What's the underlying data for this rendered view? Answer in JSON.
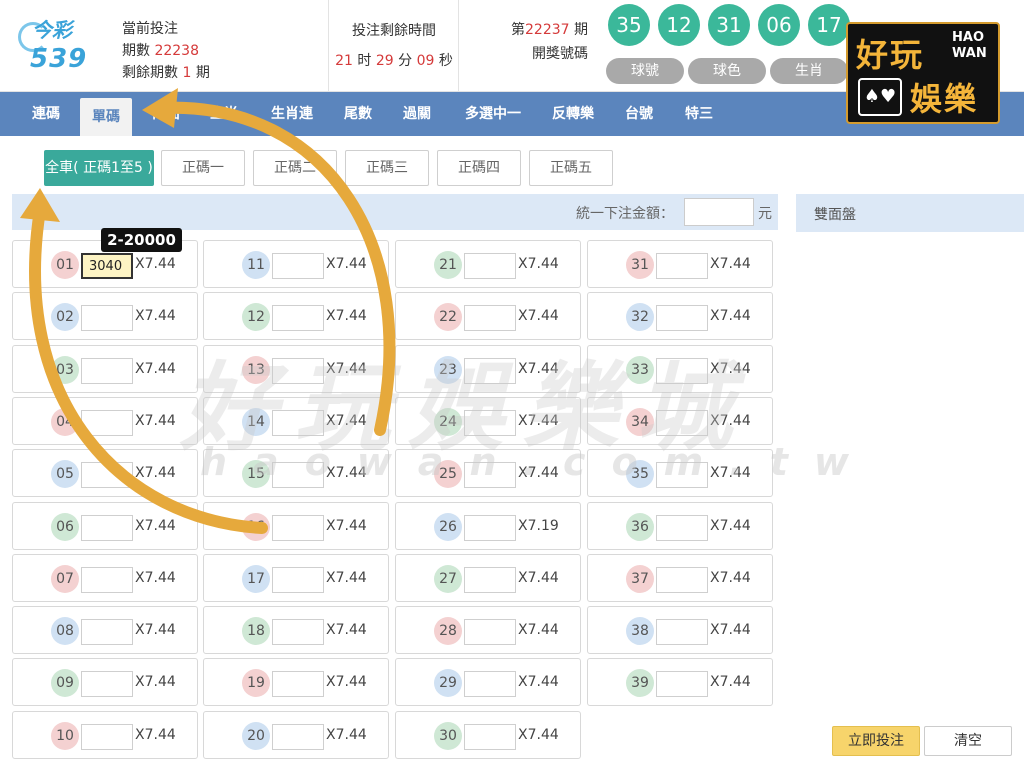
{
  "logo": {
    "top_text": "今彩",
    "num_text": "539"
  },
  "header": {
    "current_bet_label": "當前投注",
    "period_label": "期數",
    "period_value": "22238",
    "remaining_label": "剩餘期數",
    "remaining_value": "1",
    "remaining_unit": "期",
    "countdown_label": "投注剩餘時間",
    "time_h": "21",
    "time_h_unit": "时",
    "time_m": "29",
    "time_m_unit": "分",
    "time_s": "09",
    "time_s_unit": "秒",
    "draw_prefix": "第",
    "draw_period": "22237",
    "draw_suffix": "期",
    "draw_label": "開獎號碼",
    "balls": [
      "35",
      "12",
      "31",
      "06",
      "17"
    ],
    "ball_tabs": [
      "球號",
      "球色",
      "生肖"
    ]
  },
  "brand": {
    "cn1": "好玩",
    "en1": "HAO",
    "en2": "WAN",
    "cn2": "娛樂",
    "cards": "♠♥"
  },
  "nav": [
    "連碼",
    "單碼",
    "兩面",
    "生肖",
    "生肖連",
    "尾數",
    "過關",
    "多選中一",
    "反轉樂",
    "台號",
    "特三"
  ],
  "subtabs": [
    "全車( 正碼1至5 )",
    "正碼一",
    "正碼二",
    "正碼三",
    "正碼四",
    "正碼五"
  ],
  "amount": {
    "label": "統一下注金額：",
    "unit": "元"
  },
  "side_panel": {
    "title": "雙面盤"
  },
  "tooltip": "2-20000",
  "numbers": [
    {
      "n": "01",
      "c": "red",
      "odds": "X7.44",
      "val": "3040"
    },
    {
      "n": "02",
      "c": "blue",
      "odds": "X7.44",
      "val": ""
    },
    {
      "n": "03",
      "c": "green",
      "odds": "X7.44",
      "val": ""
    },
    {
      "n": "04",
      "c": "red",
      "odds": "X7.44",
      "val": ""
    },
    {
      "n": "05",
      "c": "blue",
      "odds": "X7.44",
      "val": ""
    },
    {
      "n": "06",
      "c": "green",
      "odds": "X7.44",
      "val": ""
    },
    {
      "n": "07",
      "c": "red",
      "odds": "X7.44",
      "val": ""
    },
    {
      "n": "08",
      "c": "blue",
      "odds": "X7.44",
      "val": ""
    },
    {
      "n": "09",
      "c": "green",
      "odds": "X7.44",
      "val": ""
    },
    {
      "n": "10",
      "c": "red",
      "odds": "X7.44",
      "val": ""
    },
    {
      "n": "11",
      "c": "blue",
      "odds": "X7.44",
      "val": ""
    },
    {
      "n": "12",
      "c": "green",
      "odds": "X7.44",
      "val": ""
    },
    {
      "n": "13",
      "c": "red",
      "odds": "X7.44",
      "val": ""
    },
    {
      "n": "14",
      "c": "blue",
      "odds": "X7.44",
      "val": ""
    },
    {
      "n": "15",
      "c": "green",
      "odds": "X7.44",
      "val": ""
    },
    {
      "n": "16",
      "c": "red",
      "odds": "X7.44",
      "val": ""
    },
    {
      "n": "17",
      "c": "blue",
      "odds": "X7.44",
      "val": ""
    },
    {
      "n": "18",
      "c": "green",
      "odds": "X7.44",
      "val": ""
    },
    {
      "n": "19",
      "c": "red",
      "odds": "X7.44",
      "val": ""
    },
    {
      "n": "20",
      "c": "blue",
      "odds": "X7.44",
      "val": ""
    },
    {
      "n": "21",
      "c": "green",
      "odds": "X7.44",
      "val": ""
    },
    {
      "n": "22",
      "c": "red",
      "odds": "X7.44",
      "val": ""
    },
    {
      "n": "23",
      "c": "blue",
      "odds": "X7.44",
      "val": ""
    },
    {
      "n": "24",
      "c": "green",
      "odds": "X7.44",
      "val": ""
    },
    {
      "n": "25",
      "c": "red",
      "odds": "X7.44",
      "val": ""
    },
    {
      "n": "26",
      "c": "blue",
      "odds": "X7.19",
      "val": ""
    },
    {
      "n": "27",
      "c": "green",
      "odds": "X7.44",
      "val": ""
    },
    {
      "n": "28",
      "c": "red",
      "odds": "X7.44",
      "val": ""
    },
    {
      "n": "29",
      "c": "blue",
      "odds": "X7.44",
      "val": ""
    },
    {
      "n": "30",
      "c": "green",
      "odds": "X7.44",
      "val": ""
    },
    {
      "n": "31",
      "c": "red",
      "odds": "X7.44",
      "val": ""
    },
    {
      "n": "32",
      "c": "blue",
      "odds": "X7.44",
      "val": ""
    },
    {
      "n": "33",
      "c": "green",
      "odds": "X7.44",
      "val": ""
    },
    {
      "n": "34",
      "c": "red",
      "odds": "X7.44",
      "val": ""
    },
    {
      "n": "35",
      "c": "blue",
      "odds": "X7.44",
      "val": ""
    },
    {
      "n": "36",
      "c": "green",
      "odds": "X7.44",
      "val": ""
    },
    {
      "n": "37",
      "c": "red",
      "odds": "X7.44",
      "val": ""
    },
    {
      "n": "38",
      "c": "blue",
      "odds": "X7.44",
      "val": ""
    },
    {
      "n": "39",
      "c": "green",
      "odds": "X7.44",
      "val": ""
    }
  ],
  "buttons": {
    "submit": "立即投注",
    "clear": "清空"
  },
  "watermark": {
    "cn": "好玩娛樂城",
    "en": "haowan.com.tw"
  },
  "colors": {
    "nav": "#5b85bd",
    "accent": "#3aa99b",
    "ball": "#3bb89a",
    "submit": "#f7d46b",
    "arrow": "#e6a93c"
  }
}
